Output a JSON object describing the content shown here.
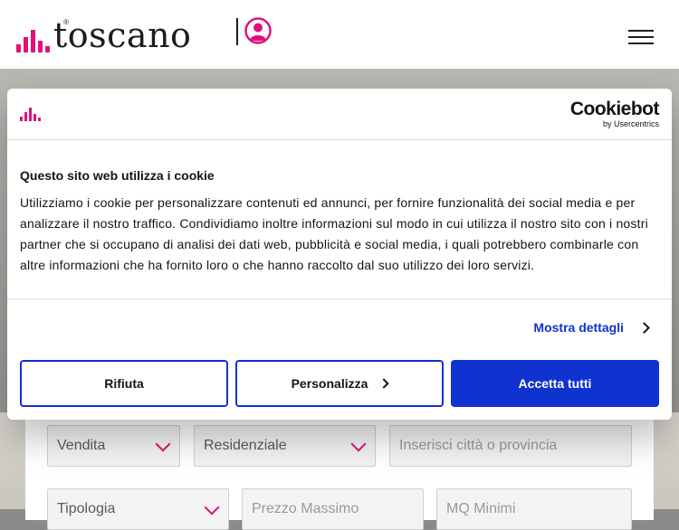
{
  "header": {
    "brand": "toscano",
    "brand_mark": "®",
    "user_icon": "user-circle-icon",
    "menu_icon": "hamburger-menu-icon"
  },
  "colors": {
    "brand_pink": "#e0117a",
    "cookie_blue": "#1032cf",
    "text_dark": "#141414"
  },
  "cookie": {
    "provider_name": "Cookiebot",
    "provider_by": "by Usercentrics",
    "title": "Questo sito web utilizza i cookie",
    "body": "Utilizziamo i cookie per personalizzare contenuti ed annunci, per fornire funzionalità dei social media e per analizzare il nostro traffico. Condividiamo inoltre informazioni sul modo in cui utilizza il nostro sito con i nostri partner che si occupano di analisi dei dati web, pubblicità e social media, i quali potrebbero combinarle con altre informazioni che ha fornito loro o che hanno raccolto dal suo utilizzo dei loro servizi.",
    "details_link": "Mostra dettagli",
    "buttons": {
      "reject": "Rifiuta",
      "customize": "Personalizza",
      "accept_all": "Accetta tutti"
    }
  },
  "search": {
    "contract": "Vendita",
    "category": "Residenziale",
    "location_placeholder": "Inserisci città o provincia",
    "type": "Tipologia",
    "max_price_placeholder": "Prezzo Massimo",
    "min_sqm_placeholder": "MQ Minimi"
  }
}
